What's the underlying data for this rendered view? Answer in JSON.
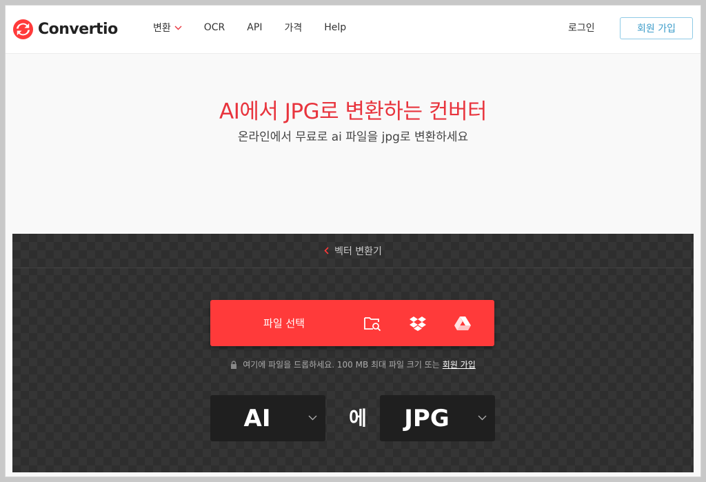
{
  "header": {
    "logo_text": "Convertio",
    "nav": [
      {
        "label": "변환",
        "has_dropdown": true
      },
      {
        "label": "OCR"
      },
      {
        "label": "API"
      },
      {
        "label": "가격"
      },
      {
        "label": "Help"
      }
    ],
    "login_label": "로그인",
    "signup_label": "회원 가입"
  },
  "hero": {
    "title": "AI에서 JPG로 변환하는 컨버터",
    "subtitle": "온라인에서 무료로 ai 파일을 jpg로 변환하세요"
  },
  "converter": {
    "back_label": "벡터 변환기",
    "choose_files_label": "파일 선택",
    "source_icons": [
      "folder-search-icon",
      "dropbox-icon",
      "google-drive-icon"
    ],
    "drop_note": "여기에 파일을 드롭하세요. 100 MB 최대 파일 크기 또는",
    "drop_note_link": "회원 가입",
    "from_format": "AI",
    "to_word": "에",
    "to_format": "JPG"
  },
  "colors": {
    "brand_red": "#ff3a3a",
    "title_red": "#e8343d",
    "signup_blue": "#3a9bc9",
    "panel_dark": "#2e2e2e"
  }
}
